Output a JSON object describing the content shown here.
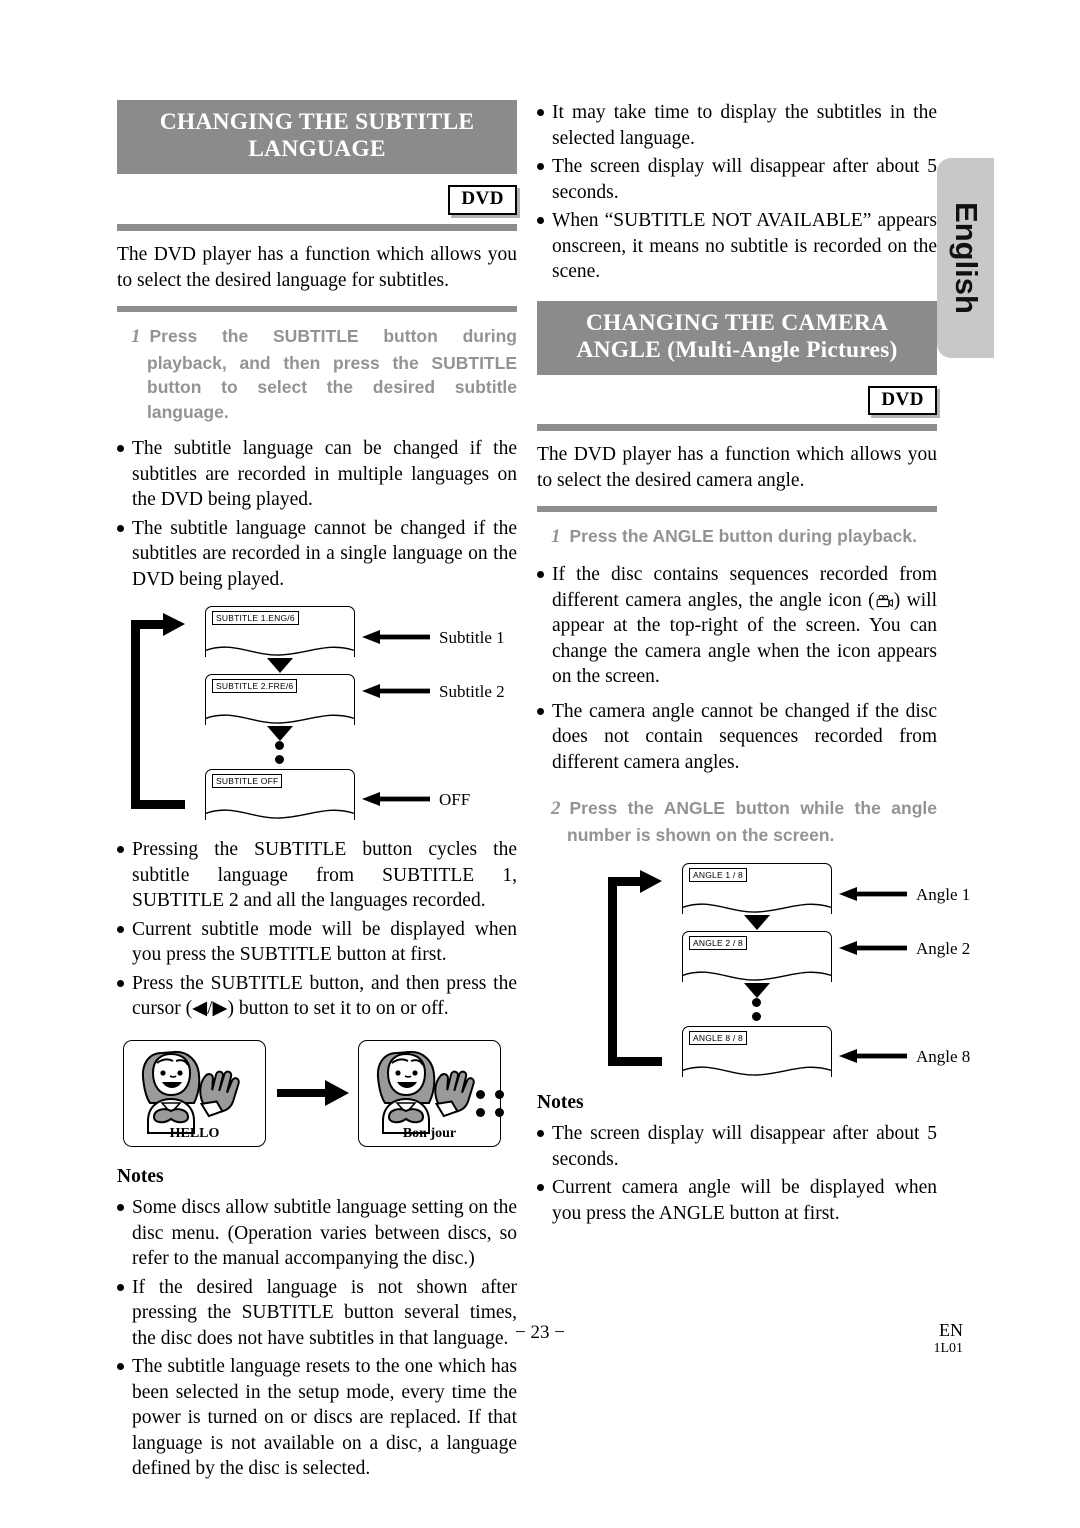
{
  "language_tab": "English",
  "left": {
    "heading_lines": [
      "CHANGING THE SUBTITLE",
      "LANGUAGE"
    ],
    "badge": "DVD",
    "intro": "The DVD player has a function which allows you to select the desired language for subtitles.",
    "step": {
      "num": "1",
      "text": "Press the SUBTITLE button during playback, and then press the SUBTITLE button to select the desired subtitle language."
    },
    "bullets_top": [
      "The subtitle language can be changed if the subtitles are recorded in multiple languages on the DVD being played.",
      "The subtitle language cannot be changed if the subtitles are recorded in a single language on the DVD being played."
    ],
    "diagram": {
      "screens": [
        {
          "osd": "SUBTITLE 1.ENG/6",
          "tag": "Subtitle 1"
        },
        {
          "osd": "SUBTITLE 2.FRE/6",
          "tag": "Subtitle 2"
        },
        {
          "osd": "SUBTITLE OFF",
          "tag": "OFF"
        }
      ]
    },
    "bullets_mid": [
      "Pressing the SUBTITLE button cycles the subtitle language from SUBTITLE 1, SUBTITLE 2 and all the languages recorded.",
      "Current subtitle mode will be displayed when you press the SUBTITLE button at first.",
      "Press the SUBTITLE button, and then press the cursor (◀/▶) button to set it to on or off."
    ],
    "pictures": {
      "frame1_caption": "HELLO",
      "frame2_caption": "Bon jour"
    },
    "notes_title": "Notes",
    "notes": [
      "Some discs allow subtitle language setting on the disc menu. (Operation varies between discs, so refer to the manual accompanying the disc.)",
      "If the desired language is not shown after pressing the SUBTITLE button several times, the disc does not have subtitles in that language.",
      "The subtitle language resets to the one which has been selected in the setup mode, every time the power is turned on or discs are replaced. If that language is not available on a disc, a language defined by the disc is selected."
    ]
  },
  "right": {
    "bullets_top": [
      "It may take time to display the subtitles in the selected language.",
      "The screen display will disappear after about 5 seconds.",
      "When “SUBTITLE NOT AVAILABLE” appears onscreen, it means no subtitle is recorded on the scene."
    ],
    "heading_lines": [
      "CHANGING THE CAMERA",
      "ANGLE (Multi-Angle Pictures)"
    ],
    "badge": "DVD",
    "intro": "The DVD player has a function which allows you to select the desired camera angle.",
    "step1": {
      "num": "1",
      "text": "Press the ANGLE button during playback."
    },
    "bullets_mid_a_pre": "If the disc contains sequences recorded from different camera angles, the angle icon (",
    "bullets_mid_a_post": ") will appear at the top-right of the screen. You can change the camera angle when the icon appears on the screen.",
    "bullets_mid_b": "The camera angle cannot be changed if the disc does not contain sequences recorded from different camera angles.",
    "step2": {
      "num": "2",
      "text": "Press the ANGLE button while the angle number is shown on the screen."
    },
    "diagram": {
      "screens": [
        {
          "osd": "ANGLE 1 / 8",
          "tag": "Angle 1"
        },
        {
          "osd": "ANGLE 2 / 8",
          "tag": "Angle 2"
        },
        {
          "osd": "ANGLE 8 / 8",
          "tag": "Angle 8"
        }
      ]
    },
    "notes_title": "Notes",
    "notes": [
      "The screen display will disappear after about 5 seconds.",
      "Current camera angle will be displayed when you press the ANGLE button at first."
    ]
  },
  "footer": {
    "page": "− 23 −",
    "region": "EN",
    "code": "1L01"
  }
}
